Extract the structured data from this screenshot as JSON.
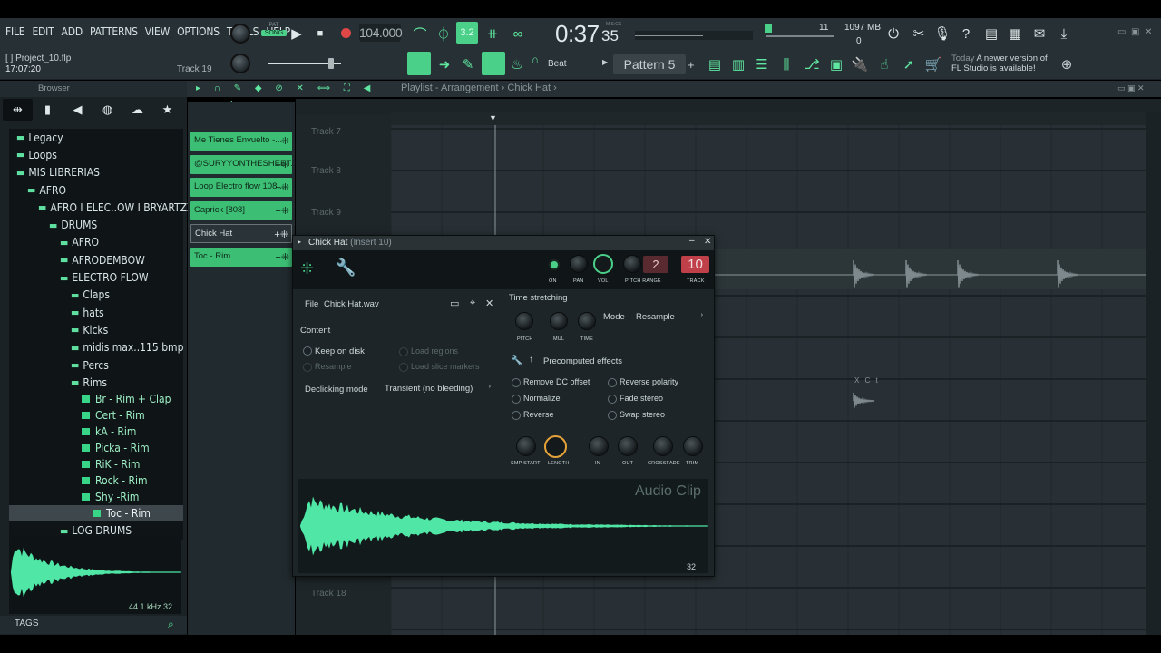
{
  "menu": [
    "FILE",
    "EDIT",
    "ADD",
    "PATTERNS",
    "VIEW",
    "OPTIONS",
    "TOOLS",
    "HELP"
  ],
  "transport": {
    "pat_label": "PAT",
    "song_label": "SONG",
    "bpm": "104.000",
    "time_main": "0:37",
    "time_sub": "35",
    "time_label": "M:S:CS",
    "step_value": "3.2",
    "cpu": "11",
    "memory": "1097 MB",
    "polyphony": "0",
    "snap": "Beat",
    "pattern": "Pattern 5"
  },
  "project": {
    "name": "[ ] Project_10.flp",
    "time": "17:07:20",
    "hint": "Track 19"
  },
  "news": {
    "day": "Today",
    "line1": "A newer version of",
    "line2": "FL Studio is available!"
  },
  "browser": {
    "title": "Browser",
    "tree": [
      {
        "label": "Legacy",
        "indent": 0,
        "type": "folder"
      },
      {
        "label": "Loops",
        "indent": 0,
        "type": "folder"
      },
      {
        "label": "MIS LIBRERIAS",
        "indent": 0,
        "type": "folder"
      },
      {
        "label": "AFRO",
        "indent": 1,
        "type": "folder"
      },
      {
        "label": "AFRO I ELEC..OW I BRYARTZZ",
        "indent": 2,
        "type": "folder"
      },
      {
        "label": "DRUMS",
        "indent": 3,
        "type": "folder"
      },
      {
        "label": "AFRO",
        "indent": 4,
        "type": "folder"
      },
      {
        "label": "AFRODEMBOW",
        "indent": 4,
        "type": "folder"
      },
      {
        "label": "ELECTRO FLOW",
        "indent": 4,
        "type": "folder"
      },
      {
        "label": "Claps",
        "indent": 5,
        "type": "folder"
      },
      {
        "label": "hats",
        "indent": 5,
        "type": "folder"
      },
      {
        "label": "Kicks",
        "indent": 5,
        "type": "folder"
      },
      {
        "label": "midis max..115 bmp",
        "indent": 5,
        "type": "folder"
      },
      {
        "label": "Percs",
        "indent": 5,
        "type": "folder"
      },
      {
        "label": "Rims",
        "indent": 5,
        "type": "folder"
      },
      {
        "label": "Br - Rim + Clap",
        "indent": 6,
        "type": "file"
      },
      {
        "label": "Cert - Rim",
        "indent": 6,
        "type": "file"
      },
      {
        "label": "kA - Rim",
        "indent": 6,
        "type": "file"
      },
      {
        "label": "Picka - Rim",
        "indent": 6,
        "type": "file"
      },
      {
        "label": "RiK - Rim",
        "indent": 6,
        "type": "file"
      },
      {
        "label": "Rock - Rim",
        "indent": 6,
        "type": "file"
      },
      {
        "label": "Shy -Rim",
        "indent": 6,
        "type": "file"
      },
      {
        "label": "Toc - Rim",
        "indent": 7,
        "type": "file",
        "selected": true
      },
      {
        "label": "LOG DRUMS",
        "indent": 4,
        "type": "folder"
      }
    ],
    "preview_info": "44.1 kHz 32",
    "tags": "TAGS"
  },
  "channels": [
    {
      "label": "Me Tienes Envuelto -...",
      "selected": false
    },
    {
      "label": "@SURYYONTHESHEET...",
      "selected": false
    },
    {
      "label": "Loop Electro flow 108...",
      "selected": false
    },
    {
      "label": "Caprick [808]",
      "selected": false
    },
    {
      "label": "Chick Hat",
      "selected": true
    },
    {
      "label": "Toc - Rim",
      "selected": false
    }
  ],
  "playlist": {
    "breadcrumb": [
      "Playlist - Arrangement",
      "Chick Hat"
    ],
    "tracks": [
      "Track 7",
      "Track 8",
      "Track 9",
      "Track 18"
    ],
    "clip_label": "X C t"
  },
  "channel_settings": {
    "title": "Chick Hat",
    "insert": "(Insert 10)",
    "pitch_range": "2",
    "track_num": "10",
    "knob_labels": {
      "on": "ON",
      "pan": "PAN",
      "vol": "VOL",
      "pitch_range": "PITCH RANGE",
      "track": "TRACK"
    },
    "file_label": "File",
    "file_name": "Chick Hat.wav",
    "content_label": "Content",
    "keep_on_disk": "Keep on disk",
    "load_regions": "Load regions",
    "resample": "Resample",
    "load_slice_markers": "Load slice markers",
    "declicking_label": "Declicking mode",
    "declicking_value": "Transient (no bleeding)",
    "time_stretching": "Time stretching",
    "ts_knobs": [
      "PITCH",
      "MUL",
      "TIME"
    ],
    "mode_label": "Mode",
    "mode_value": "Resample",
    "precomputed": "Precomputed effects",
    "effects": [
      "Remove DC offset",
      "Reverse polarity",
      "Normalize",
      "Fade stereo",
      "Reverse",
      "Swap stereo"
    ],
    "bottom_knobs": [
      "SMP START",
      "LENGTH",
      "IN",
      "OUT",
      "CROSSFADE",
      "TRIM"
    ],
    "audio_clip": "Audio Clip",
    "wave_info": "32"
  },
  "colors": {
    "accent": "#4bd08a",
    "wave": "#4fe6a6",
    "orange_knob": "#e5a33a",
    "red_badge": "#c0404a"
  }
}
